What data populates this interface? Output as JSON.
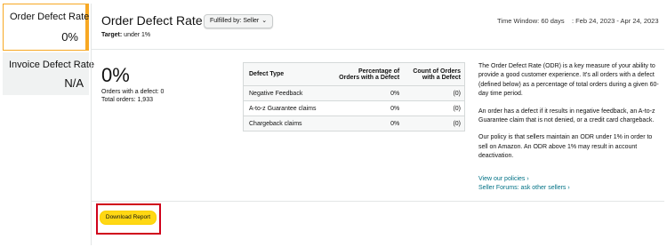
{
  "sidebar": {
    "items": [
      {
        "label": "Order Defect Rate",
        "value": "0%"
      },
      {
        "label": "Invoice Defect Rate",
        "value": "N/A"
      }
    ]
  },
  "header": {
    "title": "Order Defect Rate",
    "fulfilled_select": "Fulfilled by: Seller",
    "target_label": "Target:",
    "target_value": "under 1%",
    "time_window": "Time Window: 60 days",
    "date_range": ": Feb 24, 2023 - Apr 24, 2023"
  },
  "summary": {
    "rate": "0%",
    "orders_with_defect": "Orders with a defect: 0",
    "total_orders": "Total orders: 1,933"
  },
  "table": {
    "columns": [
      "Defect Type",
      "Percentage of Orders with a Defect",
      "Count of Orders with a Defect"
    ],
    "col2_line1": "Percentage of",
    "col2_line2": "Orders with a Defect",
    "col3_line1": "Count of Orders",
    "col3_line2": "with a Defect",
    "rows": [
      {
        "type": "Negative Feedback",
        "pct": "0%",
        "count": "(0)"
      },
      {
        "type": "A-to-z Guarantee claims",
        "pct": "0%",
        "count": "(0)"
      },
      {
        "type": "Chargeback claims",
        "pct": "0%",
        "count": "(0)"
      }
    ]
  },
  "description": {
    "p1": "The Order Defect Rate (ODR) is a key measure of your ability to provide a good customer experience. It's all orders with a defect (defined below) as a percentage of total orders during a given 60-day time period.",
    "p2": "An order has a defect if it results in negative feedback, an A-to-z Guarantee claim that is not denied, or a credit card chargeback.",
    "p3": "Our policy is that sellers maintain an ODR under 1% in order to sell on Amazon. An ODR above 1% may result in account deactivation.",
    "link_policies": "View our policies ›",
    "link_forums": "Seller Forums: ask other sellers ›"
  },
  "actions": {
    "download_label": "Download Report"
  },
  "colors": {
    "accent_orange": "#f7a823",
    "button_yellow": "#ffd814",
    "link_teal": "#007185",
    "highlight_red": "#d0021b"
  }
}
